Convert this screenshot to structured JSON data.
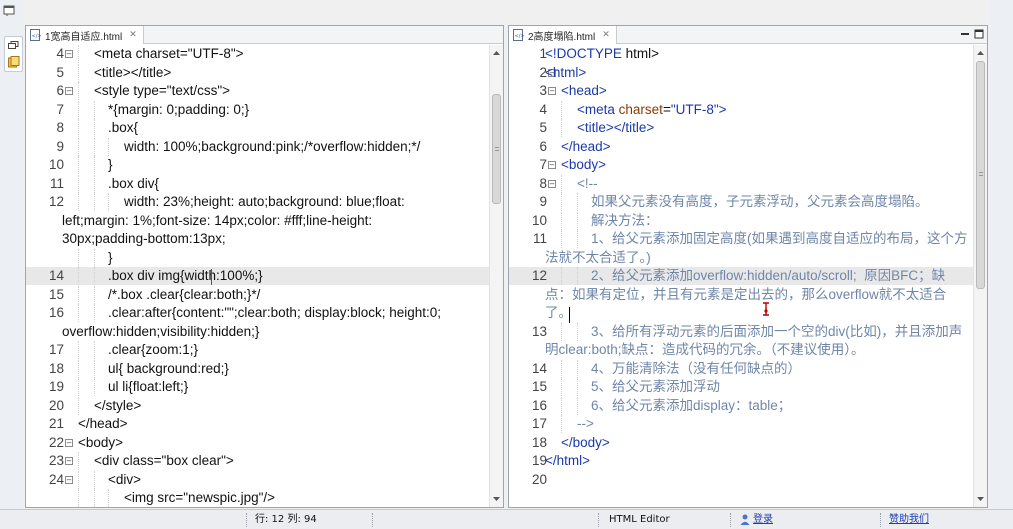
{
  "left_editor": {
    "tab_title": "1宽高自适应.html",
    "lines": [
      {
        "n": "4",
        "fold": true,
        "x": 68,
        "parts": [
          [
            "t",
            "<meta charset=\"UTF-8\">"
          ]
        ]
      },
      {
        "n": "5",
        "fold": false,
        "x": 68,
        "parts": [
          [
            "t",
            "<title></title>"
          ]
        ]
      },
      {
        "n": "6",
        "fold": true,
        "x": 68,
        "parts": [
          [
            "t",
            "<style type=\"text/css\">"
          ]
        ]
      },
      {
        "n": "7",
        "fold": false,
        "x": 82,
        "parts": [
          [
            "t",
            "*{margin: 0;padding: 0;}"
          ]
        ]
      },
      {
        "n": "8",
        "fold": false,
        "x": 82,
        "parts": [
          [
            "t",
            ".box{"
          ]
        ]
      },
      {
        "n": "9",
        "fold": false,
        "x": 98,
        "parts": [
          [
            "t",
            "width: 100%;background:pink;/*overflow:hidden;*/"
          ]
        ]
      },
      {
        "n": "10",
        "fold": false,
        "x": 82,
        "parts": [
          [
            "t",
            "}"
          ]
        ]
      },
      {
        "n": "11",
        "fold": false,
        "x": 82,
        "parts": [
          [
            "t",
            ".box div{"
          ]
        ]
      },
      {
        "n": "12",
        "fold": false,
        "x": 98,
        "parts": [
          [
            "t",
            "width: 23%;height: auto;background: blue;float:"
          ]
        ]
      },
      {
        "n": "",
        "fold": false,
        "x": 36,
        "parts": [
          [
            "t",
            "left;margin: 1%;font-size: 14px;color: #fff;line-height:"
          ]
        ]
      },
      {
        "n": "",
        "fold": false,
        "x": 36,
        "parts": [
          [
            "t",
            "30px;padding-bottom:13px;"
          ]
        ]
      },
      {
        "n": "",
        "fold": false,
        "x": 82,
        "parts": [
          [
            "t",
            "}"
          ]
        ]
      },
      {
        "n": "14",
        "fold": false,
        "x": 82,
        "cur": true,
        "parts": [
          [
            "t",
            ".box div img{width:100%;}"
          ]
        ]
      },
      {
        "n": "15",
        "fold": false,
        "x": 82,
        "parts": [
          [
            "t",
            "/*.box .clear{clear:both;}*/"
          ]
        ]
      },
      {
        "n": "16",
        "fold": false,
        "x": 82,
        "parts": [
          [
            "t",
            ".clear:after{content:\"\";clear:both; display:block; height:0;"
          ]
        ]
      },
      {
        "n": "",
        "fold": false,
        "x": 36,
        "parts": [
          [
            "t",
            "overflow:hidden;visibility:hidden;}"
          ]
        ]
      },
      {
        "n": "17",
        "fold": false,
        "x": 82,
        "parts": [
          [
            "t",
            ".clear{zoom:1;}"
          ]
        ]
      },
      {
        "n": "18",
        "fold": false,
        "x": 82,
        "parts": [
          [
            "t",
            "ul{ background:red;}"
          ]
        ]
      },
      {
        "n": "19",
        "fold": false,
        "x": 82,
        "parts": [
          [
            "t",
            "ul li{float:left;}"
          ]
        ]
      },
      {
        "n": "20",
        "fold": false,
        "x": 68,
        "parts": [
          [
            "t",
            "</style>"
          ]
        ]
      },
      {
        "n": "21",
        "fold": false,
        "x": 52,
        "parts": [
          [
            "t",
            "</head>"
          ]
        ]
      },
      {
        "n": "22",
        "fold": true,
        "x": 52,
        "parts": [
          [
            "t",
            "<body>"
          ]
        ]
      },
      {
        "n": "23",
        "fold": true,
        "x": 68,
        "parts": [
          [
            "t",
            "<div class=\"box clear\">"
          ]
        ]
      },
      {
        "n": "24",
        "fold": true,
        "x": 82,
        "parts": [
          [
            "t",
            "<div>"
          ]
        ]
      },
      {
        "n": "",
        "fold": false,
        "x": 98,
        "parts": [
          [
            "t",
            "<img src=\"newspic.jpg\"/>"
          ]
        ]
      }
    ]
  },
  "right_editor": {
    "tab_title": "2高度塌陷.html",
    "lines": [
      {
        "n": "1",
        "fold": false,
        "x": 36,
        "parts": [
          [
            "tag",
            "<!DOCTYPE"
          ],
          [
            "t",
            " html>"
          ]
        ]
      },
      {
        "n": "2",
        "fold": true,
        "x": 36,
        "parts": [
          [
            "tag",
            "<html>"
          ]
        ]
      },
      {
        "n": "3",
        "fold": true,
        "x": 52,
        "parts": [
          [
            "tag",
            "<head>"
          ]
        ]
      },
      {
        "n": "4",
        "fold": false,
        "x": 68,
        "parts": [
          [
            "tag",
            "<meta "
          ],
          [
            "attr",
            "charset"
          ],
          [
            "t",
            "="
          ],
          [
            "val",
            "\"UTF-8\""
          ],
          [
            "tag",
            ">"
          ]
        ]
      },
      {
        "n": "5",
        "fold": false,
        "x": 68,
        "parts": [
          [
            "tag",
            "<title></title>"
          ]
        ]
      },
      {
        "n": "6",
        "fold": false,
        "x": 52,
        "parts": [
          [
            "tag",
            "</head>"
          ]
        ]
      },
      {
        "n": "7",
        "fold": true,
        "x": 52,
        "parts": [
          [
            "tag",
            "<body>"
          ]
        ]
      },
      {
        "n": "8",
        "fold": true,
        "x": 68,
        "parts": [
          [
            "com",
            "<!--"
          ]
        ]
      },
      {
        "n": "9",
        "fold": false,
        "x": 82,
        "parts": [
          [
            "com",
            "如果父元素没有高度，子元素浮动，父元素会高度塌陷。"
          ]
        ]
      },
      {
        "n": "10",
        "fold": false,
        "x": 82,
        "parts": [
          [
            "com",
            "解决方法："
          ]
        ]
      },
      {
        "n": "11",
        "fold": false,
        "x": 82,
        "parts": [
          [
            "com",
            "1、给父元素添加固定高度(如果遇到高度自适应的布局，这个方"
          ]
        ]
      },
      {
        "n": "",
        "fold": false,
        "x": 36,
        "parts": [
          [
            "com",
            "法就不太合适了。)"
          ]
        ]
      },
      {
        "n": "12",
        "fold": false,
        "x": 82,
        "cur": true,
        "parts": [
          [
            "com",
            "2、给父元素添加overflow:hidden/auto/scroll;  原因BFC；缺"
          ]
        ]
      },
      {
        "n": "",
        "fold": false,
        "x": 36,
        "parts": [
          [
            "com",
            "点：如果有定位，并且有元素是定出去的，那么overflow就不太适合"
          ]
        ]
      },
      {
        "n": "",
        "fold": false,
        "x": 36,
        "parts": [
          [
            "com",
            "了。"
          ]
        ]
      },
      {
        "n": "13",
        "fold": false,
        "x": 82,
        "parts": [
          [
            "com",
            "3、给所有浮动元素的后面添加一个空的div(比如)，并且添加声"
          ]
        ]
      },
      {
        "n": "",
        "fold": false,
        "x": 36,
        "parts": [
          [
            "com",
            "明clear:both;缺点：造成代码的冗余。（不建议使用）。"
          ]
        ]
      },
      {
        "n": "14",
        "fold": false,
        "x": 82,
        "parts": [
          [
            "com",
            "4、万能清除法（没有任何缺点的）"
          ]
        ]
      },
      {
        "n": "15",
        "fold": false,
        "x": 82,
        "parts": [
          [
            "com",
            "5、给父元素添加浮动"
          ]
        ]
      },
      {
        "n": "16",
        "fold": false,
        "x": 82,
        "parts": [
          [
            "com",
            "6、给父元素添加display：table；"
          ]
        ]
      },
      {
        "n": "17",
        "fold": false,
        "x": 68,
        "parts": [
          [
            "com",
            "-->"
          ]
        ]
      },
      {
        "n": "18",
        "fold": false,
        "x": 52,
        "parts": [
          [
            "tag",
            "</body>"
          ]
        ]
      },
      {
        "n": "19",
        "fold": false,
        "x": 36,
        "parts": [
          [
            "tag",
            "</html>"
          ]
        ]
      },
      {
        "n": "20",
        "fold": false,
        "x": 36,
        "parts": []
      }
    ]
  },
  "status_bar": {
    "position": "行: 12 列: 94",
    "editor_mode": "HTML Editor",
    "login_link": "登录",
    "sponsor_link": "赞助我们"
  },
  "colors": {
    "tag": "#1a3aa8",
    "attr": "#8a3a00",
    "comment": "#6f86a8",
    "current_line": "#e8e8e8"
  }
}
